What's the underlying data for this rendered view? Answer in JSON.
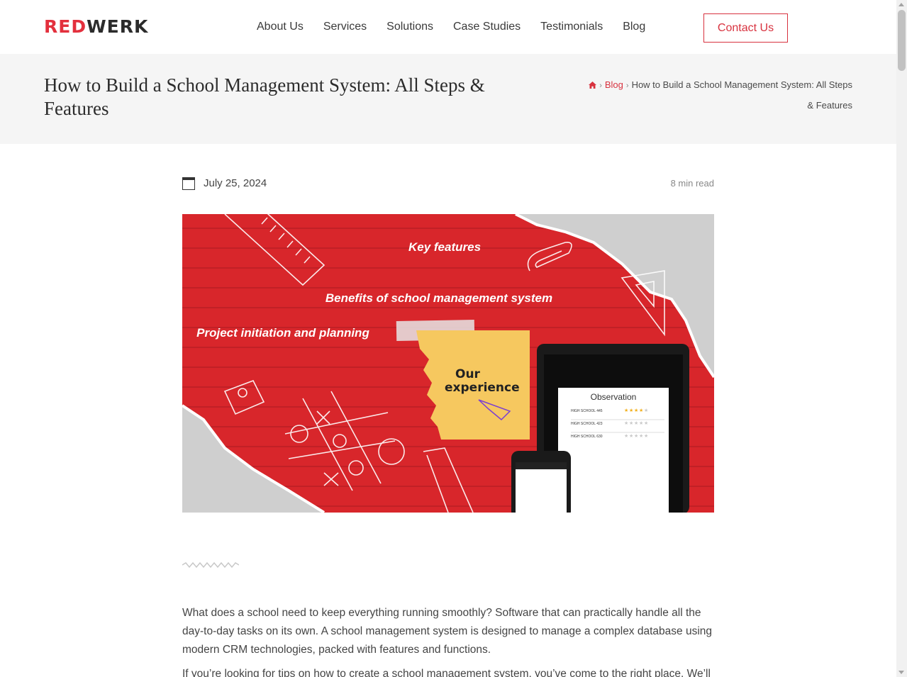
{
  "brand": {
    "logo_red": "RED",
    "logo_dark": "WERK"
  },
  "nav": {
    "items": [
      "About Us",
      "Services",
      "Solutions",
      "Case Studies",
      "Testimonials",
      "Blog"
    ],
    "contact_label": "Contact Us"
  },
  "page": {
    "title": "How to Build a School Management System: All Steps & Features",
    "breadcrumb": {
      "home_icon": "home-icon",
      "blog": "Blog",
      "current": "How to Build a School Management System: All Steps & Features"
    }
  },
  "post": {
    "date": "July 25, 2024",
    "read_time": "8 min read"
  },
  "hero": {
    "label_1": "Key features",
    "label_2": "Benefits of school management system",
    "label_3": "Project initiation and planning",
    "note_line_1": "Our",
    "note_line_2": "experience",
    "tablet_title": "Observation",
    "rows": [
      "HIGH SCHOOL 445",
      "HIGH SCHOOL 423",
      "HIGH SCHOOL 630"
    ],
    "ratings": [
      3.5,
      0,
      0
    ]
  },
  "body": {
    "p1": "What does a school need to keep everything running smoothly? Software that can practically handle all the day-to-day tasks on its own. A school management system is designed to manage a complex database using modern CRM technologies, packed with features and functions.",
    "p2": "If you’re looking for tips on how to create a school management system, you’ve come to the right place. We’ll"
  },
  "colors": {
    "accent": "#d8323f",
    "hero_red": "#d8262b",
    "note_yellow": "#f6c85f"
  }
}
